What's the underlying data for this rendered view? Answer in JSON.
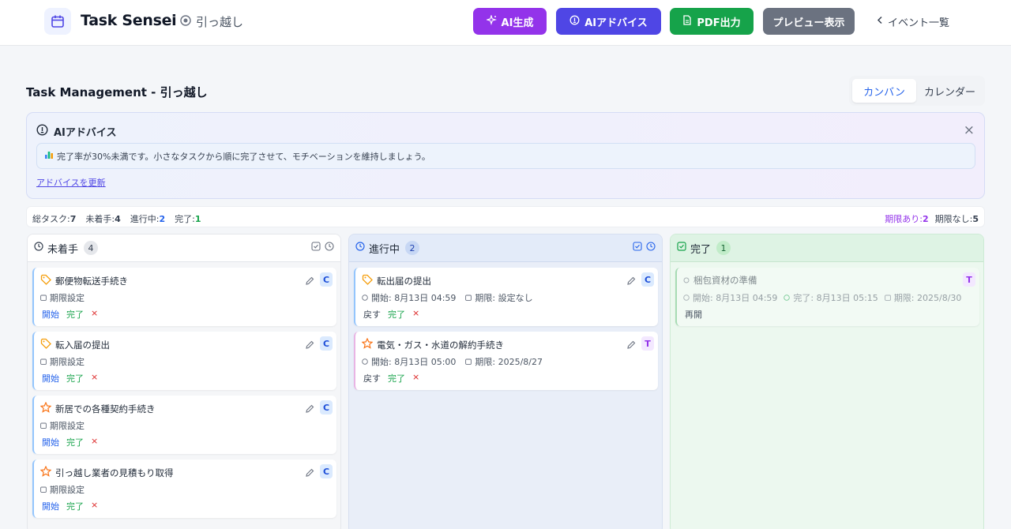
{
  "header": {
    "app_title": "Task Sensei",
    "event_name": "引っ越し",
    "buttons": {
      "ai_generate": "AI生成",
      "ai_advice": "AIアドバイス",
      "pdf": "PDF出力",
      "preview": "プレビュー表示"
    },
    "back_link": "イベント一覧"
  },
  "page": {
    "title": "Task Management - 引っ越し",
    "views": [
      "カンバン",
      "カレンダー"
    ],
    "active_view": "カンバン"
  },
  "advice": {
    "heading": "AIアドバイス",
    "message": "完了率が30%未満です。小さなタスクから順に完了させて、モチベーションを維持しましょう。",
    "refresh_link": "アドバイスを更新",
    "close": "×"
  },
  "stats": {
    "total_label": "総タスク:",
    "total": "7",
    "todo_label": "未着手:",
    "todo": "4",
    "progress_label": "進行中:",
    "progress": "2",
    "done_label": "完了:",
    "done": "1",
    "with_deadline_label": "期限あり:",
    "with_deadline": "2",
    "without_deadline_label": "期限なし:",
    "without_deadline": "5"
  },
  "colors": {
    "ai": "#9333ea",
    "advice": "#4f46e5",
    "pdf": "#16a34a",
    "preview": "#6b7280",
    "accent": "#2563eb"
  },
  "columns": {
    "todo": {
      "title": "未着手",
      "count": "4",
      "cards": [
        {
          "title": "郵便物転送手続き",
          "icon": "tag-icon",
          "tag": "C",
          "deadline": "期限設定"
        },
        {
          "title": "転入届の提出",
          "icon": "tag-icon",
          "tag": "C",
          "deadline": "期限設定"
        },
        {
          "title": "新居での各種契約手続き",
          "icon": "star-icon",
          "tag": "C",
          "deadline": "期限設定"
        },
        {
          "title": "引っ越し業者の見積もり取得",
          "icon": "star-icon",
          "tag": "C",
          "deadline": "期限設定"
        }
      ],
      "actions": {
        "start": "開始",
        "done": "完了",
        "delete": "×"
      }
    },
    "progress": {
      "title": "進行中",
      "count": "2",
      "cards": [
        {
          "title": "転出届の提出",
          "icon": "tag-icon",
          "tag": "C",
          "start": "開始: 8月13日 04:59",
          "deadline": "期限: 設定なし"
        },
        {
          "title": "電気・ガス・水道の解約手続き",
          "icon": "star-icon",
          "tag": "T",
          "start": "開始: 8月13日 05:00",
          "deadline": "期限: 2025/8/27"
        }
      ],
      "actions": {
        "back": "戻す",
        "done": "完了",
        "delete": "×"
      }
    },
    "done": {
      "title": "完了",
      "count": "1",
      "cards": [
        {
          "title": "梱包資材の準備",
          "tag": "T",
          "start": "開始: 8月13日 04:59",
          "completed": "完了: 8月13日 05:15",
          "deadline": "期限: 2025/8/30"
        }
      ],
      "actions": {
        "reopen": "再開"
      }
    }
  }
}
